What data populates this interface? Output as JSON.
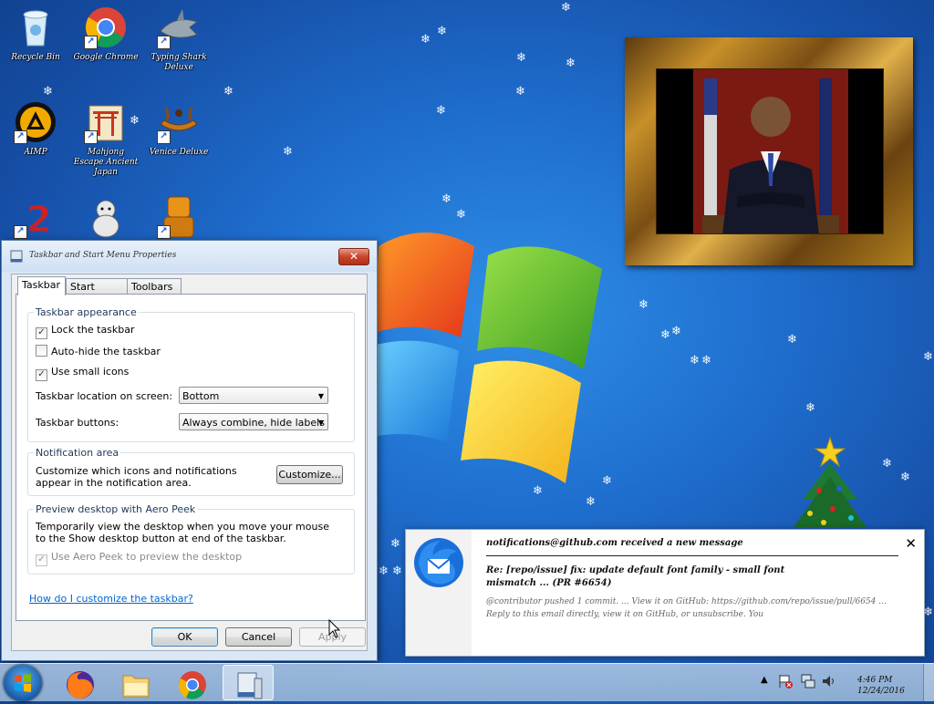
{
  "desktop": {
    "icons": [
      {
        "label": "Recycle Bin"
      },
      {
        "label": "Google Chrome"
      },
      {
        "label": "Typing Shark Deluxe"
      },
      {
        "label": "AIMP"
      },
      {
        "label": "Mahjong Escape Ancient Japan"
      },
      {
        "label": "Venice Deluxe"
      }
    ]
  },
  "dialog": {
    "title": "Taskbar and Start Menu Properties",
    "close": "✕",
    "tabs": [
      "Taskbar",
      "Start Menu",
      "Toolbars"
    ],
    "taskbar_appearance": {
      "heading": "Taskbar appearance",
      "lock": "Lock the taskbar",
      "autohide": "Auto-hide the taskbar",
      "small_icons": "Use small icons",
      "location_label": "Taskbar location on screen:",
      "location_value": "Bottom",
      "buttons_label": "Taskbar buttons:",
      "buttons_value": "Always combine, hide labels",
      "lock_checked": true,
      "autohide_checked": false,
      "small_icons_checked": true
    },
    "notification_area": {
      "heading": "Notification area",
      "desc": "Customize which icons and notifications appear in the notification area.",
      "customize": "Customize..."
    },
    "aero_peek": {
      "heading": "Preview desktop with Aero Peek",
      "desc": "Temporarily view the desktop when you move your mouse to the Show desktop button at end of the taskbar.",
      "checkbox": "Use Aero Peek to preview the desktop",
      "checked": true,
      "disabled": true
    },
    "help_link": "How do I customize the taskbar?",
    "ok": "OK",
    "cancel": "Cancel",
    "apply": "Apply"
  },
  "notification": {
    "from": "notifications@github.com received a new message",
    "subject": "Re: [repo/issue] fix: update default font family - small font mismatch ... (PR #6654)",
    "body": "@contributor pushed 1 commit. ... View it on GitHub: https://github.com/repo/issue/pull/6654 ... Reply to this email directly, view it on GitHub, or unsubscribe. You",
    "close": "✕"
  },
  "taskbar": {
    "clock_time": "4:46 PM",
    "clock_date": "12/24/2016"
  }
}
